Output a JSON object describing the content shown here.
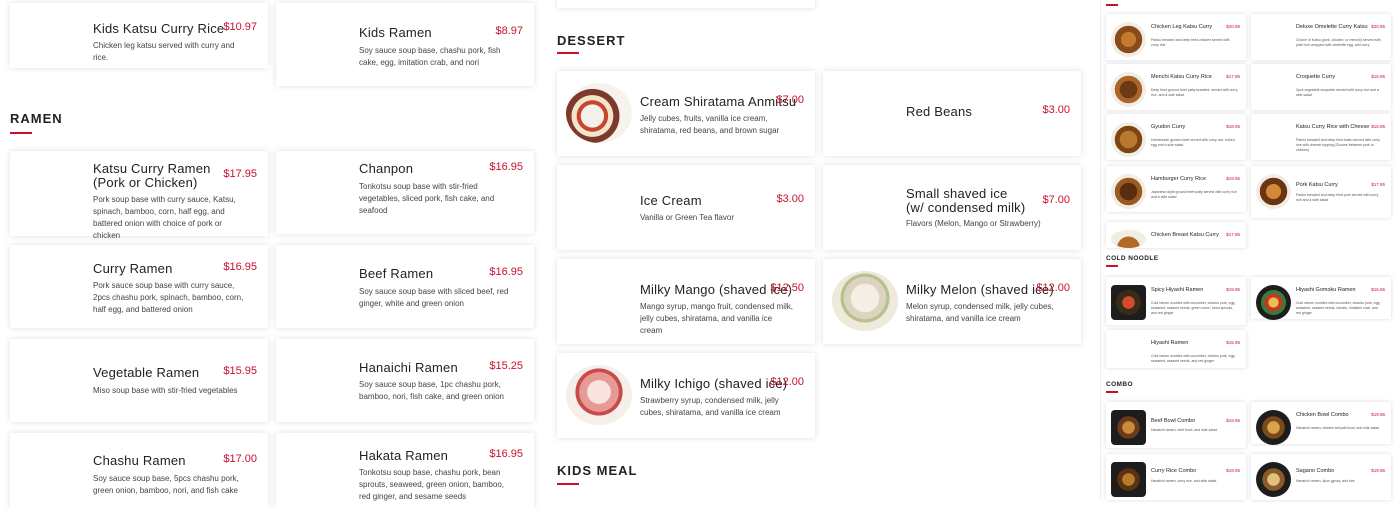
{
  "sections": {
    "ramen": "RAMEN",
    "dessert": "DESSERT",
    "kids_meal": "KIDS MEAL"
  },
  "items": {
    "kids_katsu_curry_rice": {
      "name": "Kids Katsu Curry Rice",
      "price": "$10.97",
      "desc": "Chicken leg katsu served with curry and rice."
    },
    "kids_ramen": {
      "name": "Kids Ramen",
      "price": "$8.97",
      "desc": "Soy sauce soup base, chashu pork, fish cake, egg, imitation crab, and nori"
    },
    "katsu_curry_ramen": {
      "name": "Katsu Curry Ramen (Pork or Chicken)",
      "price": "$17.95",
      "desc": "Pork soup base with curry sauce, Katsu, spinach, bamboo, corn, half egg, and battered onion with choice of pork or chicken"
    },
    "chanpon": {
      "name": "Chanpon",
      "price": "$16.95",
      "desc": "Tonkotsu soup base with stir-fried vegetables, sliced pork, fish cake, and seafood"
    },
    "curry_ramen": {
      "name": "Curry Ramen",
      "price": "$16.95",
      "desc": "Pork sauce soup base with curry sauce, 2pcs chashu pork, spinach, bamboo, corn, half egg, and battered onion"
    },
    "beef_ramen": {
      "name": "Beef Ramen",
      "price": "$16.95",
      "desc": "Soy sauce soup base with sliced beef, red ginger, white and green onion"
    },
    "vegetable_ramen": {
      "name": "Vegetable Ramen",
      "price": "$15.95",
      "desc": "Miso soup base with stir-fried vegetables"
    },
    "hanaichi_ramen": {
      "name": "Hanaichi Ramen",
      "price": "$15.25",
      "desc": "Soy sauce soup base, 1pc chashu pork, bamboo, nori, fish cake, and green onion"
    },
    "chashu_ramen": {
      "name": "Chashu Ramen",
      "price": "$17.00",
      "desc": "Soy sauce soup base, 5pcs chashu pork, green onion, bamboo, nori, and fish cake"
    },
    "hakata_ramen": {
      "name": "Hakata Ramen",
      "price": "$16.95",
      "desc": "Tonkotsu soup base, chashu pork, bean sprouts, seaweed, green onion, bamboo, red ginger, and sesame seeds"
    },
    "cream_shiratama": {
      "name": "Cream Shiratama Anmitsu",
      "price": "$7.00",
      "desc": "Jelly cubes, fruits, vanilla ice cream, shiratama, red beans, and brown sugar"
    },
    "red_beans": {
      "name": "Red Beans",
      "price": "$3.00",
      "desc": ""
    },
    "ice_cream": {
      "name": "Ice Cream",
      "price": "$3.00",
      "desc": "Vanilla or Green Tea flavor"
    },
    "small_shaved_ice": {
      "name": "Small shaved ice (w/ condensed milk)",
      "price": "$7.00",
      "desc": "Flavors (Melon, Mango or Strawberry)"
    },
    "milky_mango": {
      "name": "Milky Mango (shaved ice)",
      "price": "$12.50",
      "desc": "Mango syrup, mango fruit, condensed milk, jelly cubes, shiratama, and vanilla ice cream"
    },
    "milky_melon": {
      "name": "Milky Melon (shaved ice)",
      "price": "$12.00",
      "desc": "Melon syrup, condensed milk, jelly cubes, shiratama, and vanilla ice cream"
    },
    "milky_ichigo": {
      "name": "Milky Ichigo (shaved ice)",
      "price": "$12.00",
      "desc": "Strawberry syrup, condensed milk, jelly cubes, shiratama, and vanilla ice cream"
    }
  },
  "sidebar": {
    "sections": {
      "cold_noodle": "COLD NOODLE",
      "combo": "COMBO"
    },
    "items": [
      {
        "name": "Chicken Leg Katsu Curry",
        "price": "$20.95",
        "desc": "Panko breaded and deep fried chicken served with curry rice"
      },
      {
        "name": "Deluxe Omelette Curry Katsu",
        "price": "$20.95",
        "desc": "Choice of Katsu (pork, chicken, or menchi) served with plain rice wrapped with omelette egg, and curry"
      },
      {
        "name": "Menchi Katsu Curry Rice",
        "price": "$17.95",
        "desc": "Deep fried ground beef patty breaded, served with curry rice, and a side salad"
      },
      {
        "name": "Croquette Curry",
        "price": "$18.95",
        "desc": "2pcs vegetable croquette served with curry rice and a side salad"
      },
      {
        "name": "Gyudon Curry",
        "price": "$18.95",
        "desc": "Homemade gyudon beef served with curry rice, boiled egg and a side salad"
      },
      {
        "name": "Katsu Curry Rice with Cheese",
        "price": "$18.95",
        "desc": "Panko breaded and deep fried katsu served with curry rice with cheese topping (Choose between pork or chicken)"
      },
      {
        "name": "Hamburger Curry Rice",
        "price": "$19.95",
        "desc": "Japanese-style ground beef patty served with curry rice and a side salad"
      },
      {
        "name": "Pork Katsu Curry",
        "price": "$17.95",
        "desc": "Panko breaded and deep fried pork served with curry rice and a side salad"
      },
      {
        "name": "Chicken Breast Katsu Curry",
        "price": "$17.95",
        "desc": ""
      },
      {
        "name": "Spicy Hiyashi Ramen",
        "price": "$19.95",
        "desc": "Cold ramen noodles with cucumber, chashu pork, egg, seaweed, sesame seeds, green onion, bean sprouts, and red ginger"
      },
      {
        "name": "Hiyashi Gomoku Ramen",
        "price": "$16.95",
        "desc": "Cold ramen noodles with cucumber, chashu pork, egg, seaweed, sesame seeds, tomato, imitation crab, and red ginger"
      },
      {
        "name": "Hiyashi Ramen",
        "price": "$15.95",
        "desc": "Cold ramen noodles with cucumber, chashu pork, egg, seaweed, sesame seeds, and red ginger"
      },
      {
        "name": "Beef Bowl Combo",
        "price": "$19.95",
        "desc": "Hanaichi ramen, beef bowl, and side salad"
      },
      {
        "name": "Chicken Bowl Combo",
        "price": "$19.95",
        "desc": "Hanaichi ramen, chicken teriyaki bowl, and side salad"
      },
      {
        "name": "Curry Rice Combo",
        "price": "$19.95",
        "desc": "Hanaichi ramen, curry rice, and side salad"
      },
      {
        "name": "Sagano Combo",
        "price": "$19.95",
        "desc": "Hanaichi ramen, 4pcs gyoza, and rice"
      }
    ]
  },
  "colors": {
    "accent": "#c8102e"
  }
}
